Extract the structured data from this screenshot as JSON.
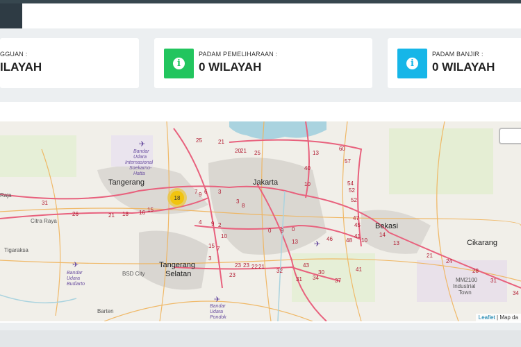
{
  "colors": {
    "green": "#22c55e",
    "cyan": "#16b6e8",
    "road_major": "#e8617d",
    "road_minor": "#f0b35a",
    "cluster": "#f1c40f"
  },
  "cards": [
    {
      "label": "GGUAN :",
      "value": "ILAYAH",
      "icon": "info-icon"
    },
    {
      "label": "PADAM PEMELIHARAAN :",
      "value": "0 WILAYAH",
      "icon": "info-icon",
      "color": "#22c55e"
    },
    {
      "label": "PADAM BANJIR :",
      "value": "0 WILAYAH",
      "icon": "info-icon",
      "color": "#16b6e8"
    }
  ],
  "map": {
    "cities": [
      "Tangerang",
      "Jakarta",
      "Bekasi",
      "Cikarang",
      "Tangerang",
      "Selatan"
    ],
    "places": [
      "Raja",
      "Citra Raya",
      "Tigaraksa",
      "BSD City",
      "Barten",
      "MM2100",
      "Industrial",
      "Town"
    ],
    "pois": [
      "Bandar",
      "Udara",
      "Internasional",
      "Soekarno-",
      "Hatta",
      "Bandar",
      "Udara",
      "Budiarto",
      "Bandar",
      "Udara",
      "Pondok"
    ],
    "cluster_count": "18",
    "route_numbers": [
      "25",
      "21",
      "20",
      "21",
      "25",
      "13",
      "60",
      "57",
      "54",
      "52",
      "52",
      "47",
      "45",
      "41",
      "40",
      "46",
      "48",
      "10",
      "10",
      "14",
      "13",
      "21",
      "24",
      "28",
      "31",
      "34",
      "31",
      "26",
      "21",
      "18",
      "16",
      "15",
      "9",
      "7",
      "6",
      "3",
      "3",
      "8",
      "9",
      "4",
      "2",
      "0",
      "9",
      "7",
      "0",
      "10",
      "13",
      "23",
      "23",
      "22",
      "21",
      "32",
      "31",
      "34",
      "37",
      "41",
      "43",
      "30",
      "23",
      "15",
      "3"
    ],
    "attribution_link": "Leaflet",
    "attribution_text": "| Map da"
  }
}
